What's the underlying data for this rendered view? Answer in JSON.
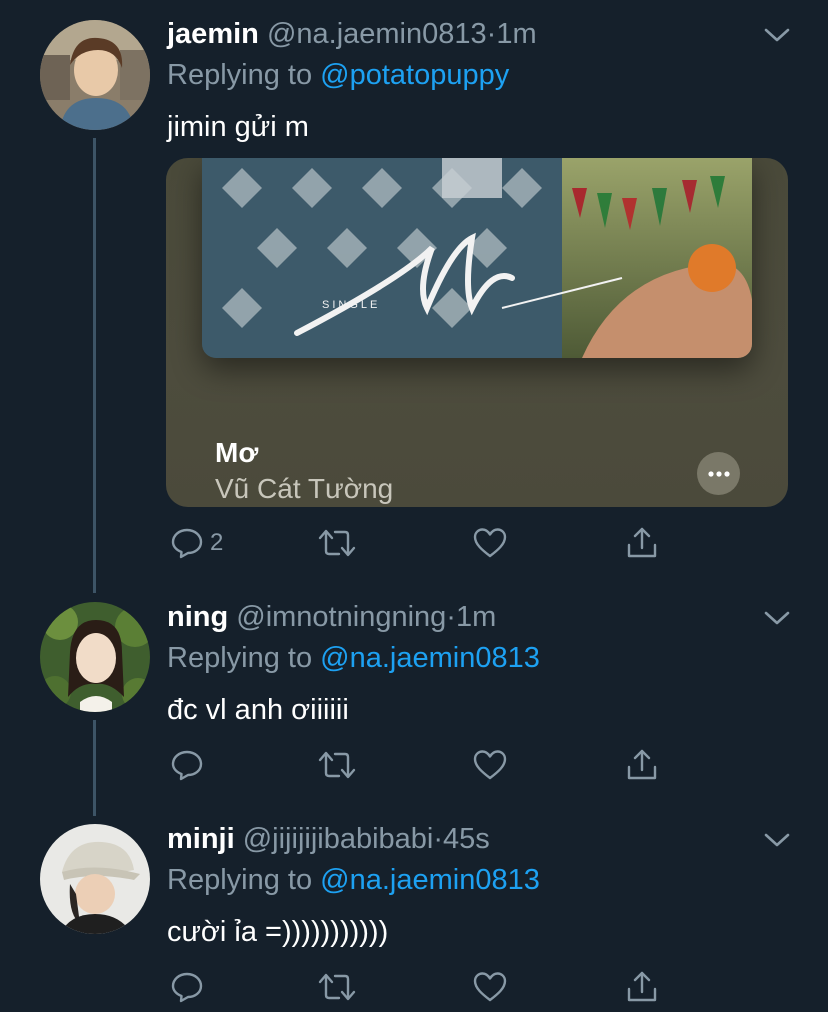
{
  "tweets": [
    {
      "name": "jaemin",
      "handle": "@na.jaemin0813",
      "separator": "·",
      "time": "1m",
      "reply_prefix": "Replying to ",
      "reply_to": "@potatopuppy",
      "text": "jimin gửi m",
      "card": {
        "art_label": "SINGLE",
        "title": "Mơ",
        "artist": "Vũ Cát Tường"
      },
      "reply_count": "2"
    },
    {
      "name": "ning",
      "handle": "@imnotningning",
      "separator": "·",
      "time": "1m",
      "reply_prefix": "Replying to ",
      "reply_to": "@na.jaemin0813",
      "text": "đc vl anh ơiiiiii"
    },
    {
      "name": "minji",
      "handle": "@jijijijibabibabi",
      "separator": "·",
      "time": "45s",
      "reply_prefix": "Replying to ",
      "reply_to": "@na.jaemin0813",
      "text": "cười ỉa =)))))))))))"
    }
  ],
  "icons": {
    "reply": "speech-bubble-icon",
    "retweet": "retweet-icon",
    "like": "heart-icon",
    "share": "share-icon",
    "menu": "chevron-down-icon",
    "card_more": "more-dots-icon"
  },
  "colors": {
    "background": "#15202b",
    "secondary_text": "#8899a6",
    "link": "#1da1f2",
    "thread_line": "#3d5466"
  }
}
